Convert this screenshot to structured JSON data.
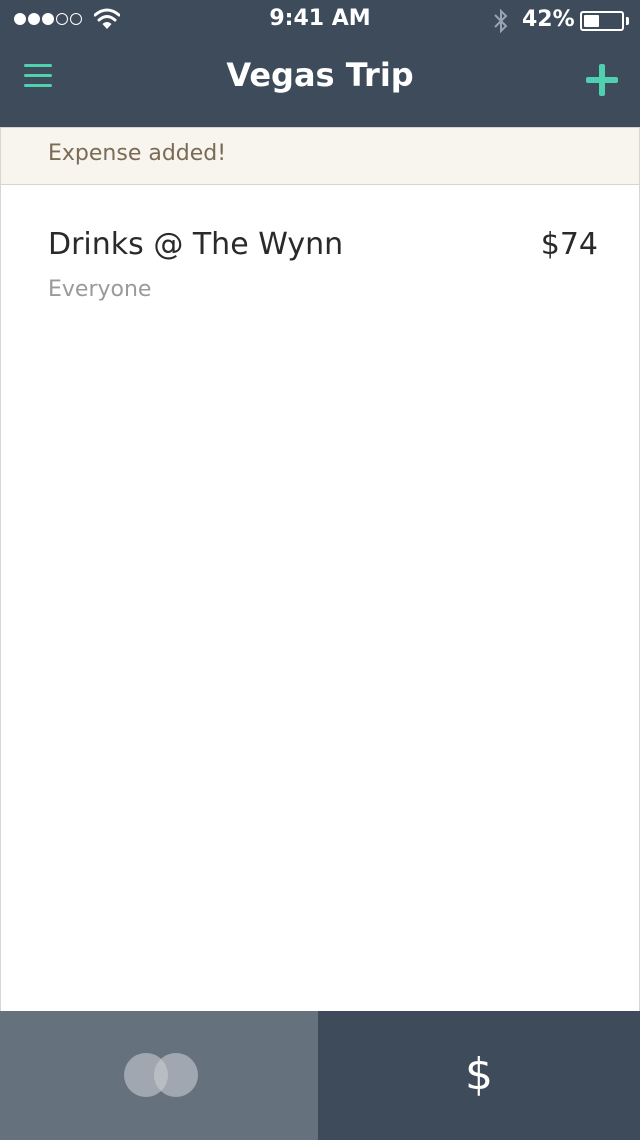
{
  "status_bar": {
    "carrier_signal": "●●●○○",
    "time": "9:41 AM",
    "battery_percent": "42%",
    "battery_level": 0.42,
    "icons": [
      "wifi-icon",
      "bluetooth-icon",
      "battery-icon"
    ]
  },
  "nav": {
    "title": "Vegas Trip",
    "left_icon": "menu-icon",
    "right_icon": "plus-icon"
  },
  "toast": {
    "message": "Expense added!"
  },
  "expenses": [
    {
      "name": "Drinks @ The Wynn",
      "amount": "$74",
      "split": "Everyone"
    }
  ],
  "tabs": {
    "people_icon": "people-circles-icon",
    "dollar_label": "$"
  },
  "colors": {
    "header_bg": "#3e4b5b",
    "accent": "#4fd1b0",
    "toast_bg": "#f8f4ee",
    "tab_active_bg": "#66717e"
  }
}
